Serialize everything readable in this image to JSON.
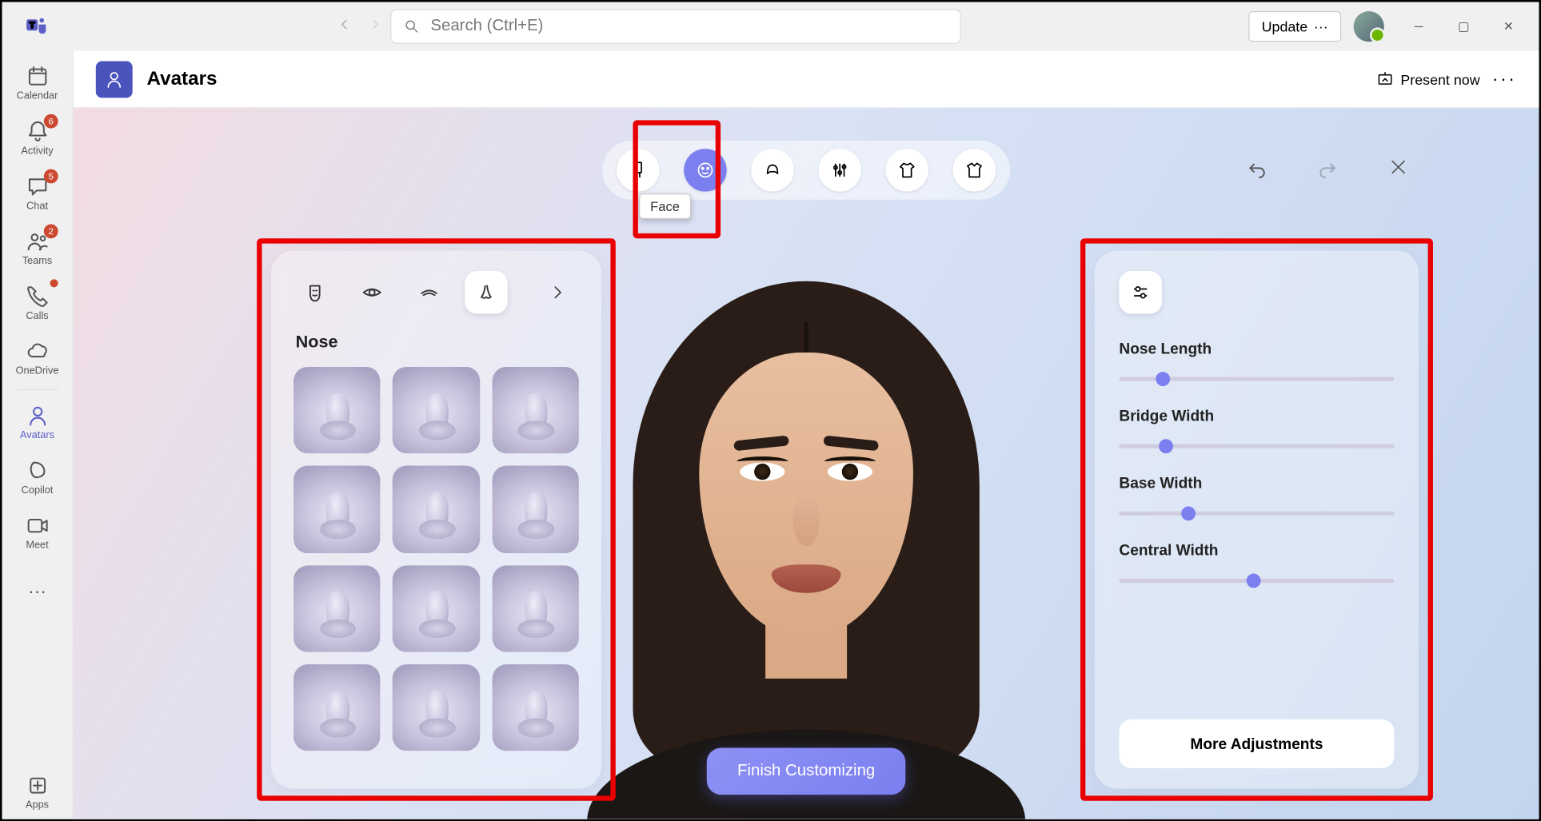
{
  "titlebar": {
    "search_placeholder": "Search (Ctrl+E)",
    "update_label": "Update"
  },
  "rail": {
    "items": [
      {
        "label": "Calendar",
        "badge": null
      },
      {
        "label": "Activity",
        "badge": "6"
      },
      {
        "label": "Chat",
        "badge": "5"
      },
      {
        "label": "Teams",
        "badge": "2"
      },
      {
        "label": "Calls",
        "badge": "dot"
      },
      {
        "label": "OneDrive",
        "badge": null
      },
      {
        "label": "Avatars",
        "badge": null,
        "active": true
      },
      {
        "label": "Copilot",
        "badge": null
      },
      {
        "label": "Meet",
        "badge": null
      }
    ],
    "apps_label": "Apps"
  },
  "header": {
    "title": "Avatars",
    "present_label": "Present now"
  },
  "categories": {
    "active_tooltip": "Face"
  },
  "left_panel": {
    "title": "Nose",
    "swatch_count": 12
  },
  "right_panel": {
    "sliders": [
      {
        "label": "Nose Length",
        "value": 16
      },
      {
        "label": "Bridge Width",
        "value": 17
      },
      {
        "label": "Base Width",
        "value": 25
      },
      {
        "label": "Central Width",
        "value": 49
      }
    ],
    "more_label": "More Adjustments"
  },
  "finish_label": "Finish Customizing",
  "colors": {
    "accent": "#7b7ff0",
    "highlight": "#e90000"
  }
}
